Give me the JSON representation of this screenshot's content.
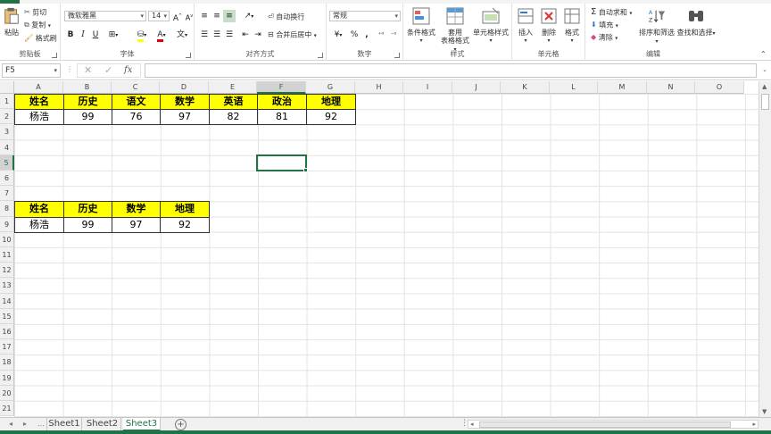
{
  "ribbon": {
    "clipboard": {
      "paste": "粘贴",
      "cut": "剪切",
      "copy": "复制",
      "format_painter": "格式刷",
      "label": "剪贴板"
    },
    "font": {
      "name": "微软雅黑",
      "size": "14",
      "bold": "B",
      "italic": "I",
      "underline": "U",
      "grow": "A",
      "shrink": "A",
      "color_a": "A",
      "wen": "文",
      "label": "字体"
    },
    "alignment": {
      "wrap": "自动换行",
      "merge": "合并后居中",
      "label": "对齐方式"
    },
    "number": {
      "format": "常规",
      "percent": "%",
      "comma": ",",
      "label": "数字"
    },
    "styles": {
      "conditional": "条件格式",
      "table_fmt_1": "套用",
      "table_fmt_2": "表格格式",
      "cell_styles": "单元格样式",
      "label": "样式"
    },
    "cells": {
      "insert": "插入",
      "delete": "删除",
      "format": "格式",
      "label": "单元格"
    },
    "editing": {
      "autosum": "自动求和",
      "fill": "填充",
      "clear": "清除",
      "sort_filter": "排序和筛选",
      "find_select": "查找和选择",
      "label": "编辑",
      "sigma": "Σ"
    }
  },
  "formula_bar": {
    "name_box": "F5",
    "fx": "fx",
    "cancel": "✕",
    "enter": "✓",
    "value": ""
  },
  "columns": [
    "A",
    "B",
    "C",
    "D",
    "E",
    "F",
    "G",
    "H",
    "I",
    "J",
    "K",
    "L",
    "M",
    "N",
    "O"
  ],
  "rows": [
    "1",
    "2",
    "3",
    "4",
    "5",
    "6",
    "7",
    "8",
    "9",
    "10",
    "11",
    "12",
    "13",
    "14",
    "15",
    "16",
    "17",
    "18",
    "19",
    "20",
    "21"
  ],
  "active_cell": {
    "col": "F",
    "row": "5"
  },
  "table1": {
    "headers": [
      "姓名",
      "历史",
      "语文",
      "数学",
      "英语",
      "政治",
      "地理"
    ],
    "values": [
      "杨浩",
      "99",
      "76",
      "97",
      "82",
      "81",
      "92"
    ]
  },
  "table2": {
    "headers": [
      "姓名",
      "历史",
      "数学",
      "地理"
    ],
    "values": [
      "杨浩",
      "99",
      "97",
      "92"
    ]
  },
  "sheets": [
    "Sheet1",
    "Sheet2",
    "Sheet3"
  ],
  "active_sheet": "Sheet3",
  "add_sheet": "+",
  "colors": {
    "accent": "#217346",
    "header_fill": "#ffff00"
  }
}
